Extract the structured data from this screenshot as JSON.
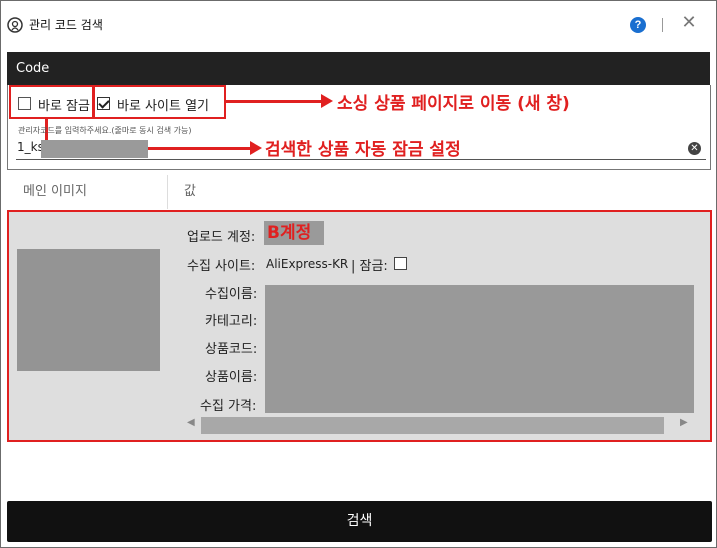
{
  "window": {
    "title": "관리 코드 검색",
    "help_glyph": "?",
    "close_glyph": "✕"
  },
  "code_header": "Code",
  "options": {
    "instant_lock_label": "바로 잠금",
    "instant_lock_checked": false,
    "open_site_label": "바로 사이트 열기",
    "open_site_checked": true
  },
  "annotations": {
    "open_site_note": "소싱 상품 페이지로 이동 (새 창)",
    "lock_note": "검색한 상품 자동 잠금 설정"
  },
  "search": {
    "hint": "관리자코드를 입력하주세요.(줄마로 동시 검색 가능)",
    "value": "1_ks"
  },
  "table": {
    "col_image": "메인 이미지",
    "col_value": "값"
  },
  "result": {
    "upload_account_label": "업로드 계정:",
    "upload_account_value": "B계정",
    "source_site_label": "수집 사이트:",
    "source_site_value": "AliExpress-KR",
    "lock_label": "| 잠금:",
    "source_name_label": "수집이름:",
    "category_label": "카테고리:",
    "product_code_label": "상품코드:",
    "product_name_label": "상품이름:",
    "source_price_label": "수집 가격:"
  },
  "search_button": "검색",
  "colors": {
    "accent_red": "#e02020",
    "header_dark": "#222222",
    "help_blue": "#1a6fd0"
  }
}
